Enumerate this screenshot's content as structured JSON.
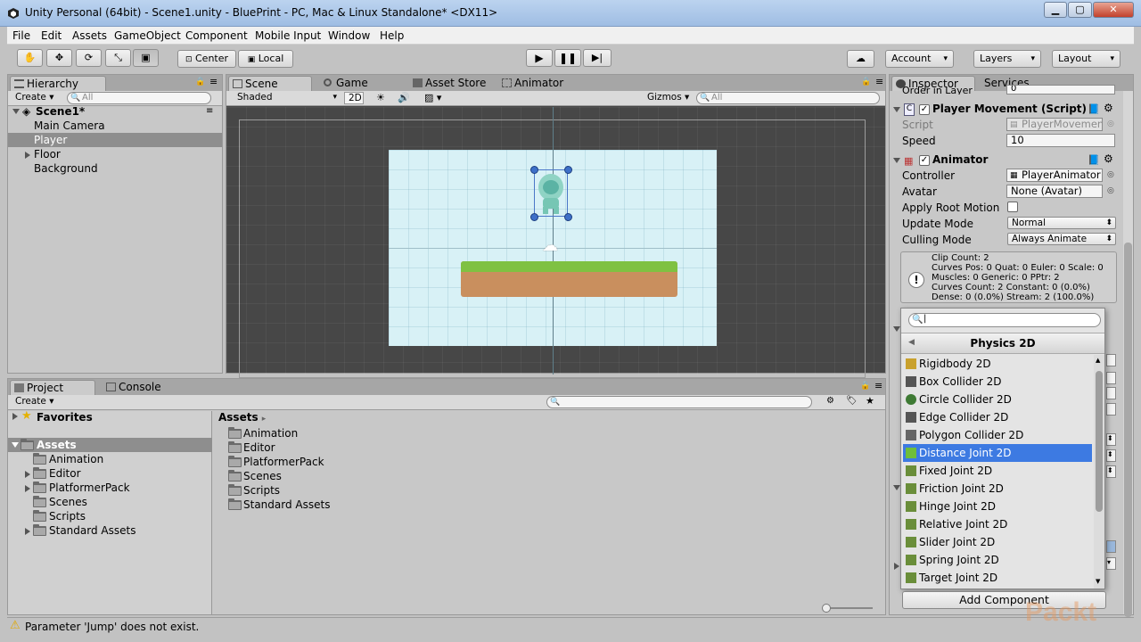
{
  "window": {
    "title": "Unity Personal (64bit) - Scene1.unity - BluePrint - PC, Mac & Linux Standalone* <DX11>"
  },
  "menubar": [
    "File",
    "Edit",
    "Assets",
    "GameObject",
    "Component",
    "Mobile Input",
    "Window",
    "Help"
  ],
  "toolbar": {
    "pivot_label": "Center",
    "space_label": "Local",
    "account_label": "Account",
    "layers_label": "Layers",
    "layout_label": "Layout"
  },
  "hierarchy": {
    "tab": "Hierarchy",
    "create": "Create",
    "search_placeholder": "All",
    "scene": "Scene1*",
    "items": [
      "Main Camera",
      "Player",
      "Floor",
      "Background"
    ]
  },
  "scene_view": {
    "tabs": [
      "Scene",
      "Game",
      "Asset Store",
      "Animator"
    ],
    "shading": "Shaded",
    "mode_2d": "2D",
    "gizmos": "Gizmos",
    "search_placeholder": "All"
  },
  "project": {
    "tabs": [
      "Project",
      "Console"
    ],
    "create": "Create",
    "favorites": "Favorites",
    "assets_root": "Assets",
    "tree": [
      "Animation",
      "Editor",
      "PlatformerPack",
      "Scenes",
      "Scripts",
      "Standard Assets"
    ],
    "breadcrumb": "Assets",
    "files": [
      "Animation",
      "Editor",
      "PlatformerPack",
      "Scenes",
      "Scripts",
      "Standard Assets"
    ]
  },
  "inspector": {
    "tabs": [
      "Inspector",
      "Services"
    ],
    "order_in_layer_label": "Order in Layer",
    "order_in_layer_value": "0",
    "player_movement": {
      "title": "Player Movement (Script)",
      "script_label": "Script",
      "script_value": "PlayerMovemen",
      "speed_label": "Speed",
      "speed_value": "10"
    },
    "animator": {
      "title": "Animator",
      "controller_label": "Controller",
      "controller_value": "PlayerAnimator",
      "avatar_label": "Avatar",
      "avatar_value": "None (Avatar)",
      "root_motion_label": "Apply Root Motion",
      "update_mode_label": "Update Mode",
      "update_mode_value": "Normal",
      "culling_mode_label": "Culling Mode",
      "culling_mode_value": "Always Animate",
      "info": [
        "Clip Count: 2",
        "Curves Pos: 0 Quat: 0 Euler: 0 Scale: 0",
        "Muscles: 0 Generic: 0 PPtr: 2",
        "Curves Count: 2 Constant: 0 (0.0%)",
        "Dense: 0 (0.0%) Stream: 2 (100.0%)"
      ]
    },
    "add_component": "Add Component"
  },
  "popup": {
    "category": "Physics 2D",
    "items": [
      {
        "label": "Rigidbody 2D",
        "icon": "rigidbody-icon",
        "color": "#c9a12d"
      },
      {
        "label": "Box Collider 2D",
        "icon": "box-collider-icon",
        "color": "#555555"
      },
      {
        "label": "Circle Collider 2D",
        "icon": "circle-collider-icon",
        "color": "#3e7a34"
      },
      {
        "label": "Edge Collider 2D",
        "icon": "edge-collider-icon",
        "color": "#555555"
      },
      {
        "label": "Polygon Collider 2D",
        "icon": "polygon-collider-icon",
        "color": "#666666"
      },
      {
        "label": "Distance Joint 2D",
        "icon": "distance-joint-icon",
        "color": "#6fbe3a"
      },
      {
        "label": "Fixed Joint 2D",
        "icon": "fixed-joint-icon",
        "color": "#6a8e3a"
      },
      {
        "label": "Friction Joint 2D",
        "icon": "friction-joint-icon",
        "color": "#6a8e3a"
      },
      {
        "label": "Hinge Joint 2D",
        "icon": "hinge-joint-icon",
        "color": "#6a8e3a"
      },
      {
        "label": "Relative Joint 2D",
        "icon": "relative-joint-icon",
        "color": "#6a8e3a"
      },
      {
        "label": "Slider Joint 2D",
        "icon": "slider-joint-icon",
        "color": "#6a8e3a"
      },
      {
        "label": "Spring Joint 2D",
        "icon": "spring-joint-icon",
        "color": "#6a8e3a"
      },
      {
        "label": "Target Joint 2D",
        "icon": "target-joint-icon",
        "color": "#6a8e3a"
      }
    ],
    "highlighted": "Distance Joint 2D"
  },
  "status": {
    "message": "Parameter 'Jump' does not exist."
  },
  "watermark": "Packt"
}
